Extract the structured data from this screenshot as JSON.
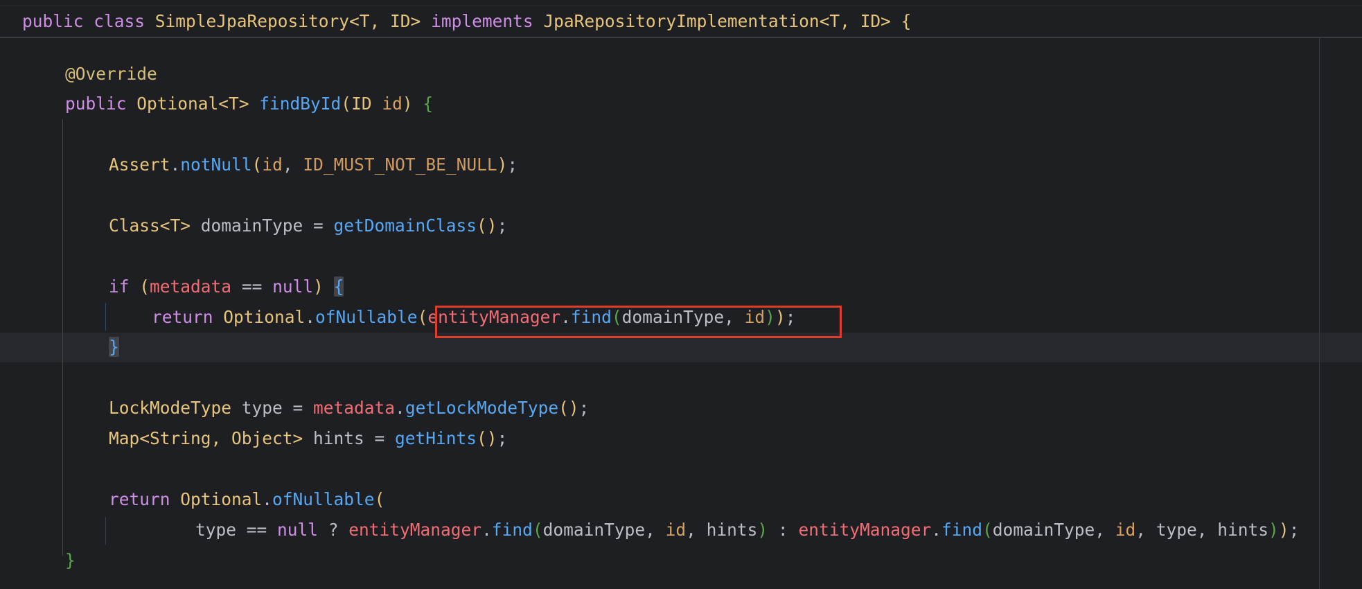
{
  "editor": {
    "language": "Java",
    "theme": {
      "background": "#1e1f22",
      "caret_row": "#26282e",
      "keyword": "#cf8ee6",
      "type": "#e7c47b",
      "function": "#56a8f5",
      "field": "#f26d73",
      "parameter": "#d9a15f",
      "default_text": "#bcbec4",
      "highlight_box": "#e03c2a"
    },
    "highlight": {
      "description": "red rectangle",
      "text": "(entityManager.find(domainType, id));"
    }
  },
  "code": {
    "l1": {
      "t1": "public",
      "t2": " ",
      "t3": "class",
      "t4": " SimpleJpaRepository<T, ID> ",
      "t5": "implements",
      "t6": " JpaRepositoryImplementation<T, ID> ",
      "t7": "{"
    },
    "l2": {
      "t1": "@Override"
    },
    "l3": {
      "t1": "public",
      "t2": " Optional<T> ",
      "t3": "findById",
      "t4": "(",
      "t5": "ID ",
      "t6": "id",
      "t7": ") ",
      "t8": "{"
    },
    "l4": {
      "t1": "Assert",
      "t2": ".",
      "t3": "notNull",
      "t4": "(",
      "t5": "id",
      "t6": ", ",
      "t7": "ID_MUST_NOT_BE_NULL",
      "t8": ")",
      "t9": ";"
    },
    "l5": {
      "t1": "Class<T>",
      "t2": " domainType = ",
      "t3": "getDomainClass",
      "t4": "()",
      "t5": ";"
    },
    "l6": {
      "t1": "if",
      "t2": " ",
      "t3": "(",
      "t4": "metadata",
      "t5": " == ",
      "t6": "null",
      "t7": ") ",
      "t8": "{"
    },
    "l7": {
      "t1": "return",
      "t2": " Optional",
      "t3": ".",
      "t4": "ofNullable",
      "t5": "(",
      "t6": "entityManager",
      "t7": ".",
      "t8": "find",
      "t9": "(",
      "t10": "domainType, ",
      "t11": "id",
      "t12": ")",
      "t13": ")",
      "t14": ";"
    },
    "l8": {
      "t1": "}"
    },
    "l9": {
      "t1": "LockModeType",
      "t2": " type = ",
      "t3": "metadata",
      "t4": ".",
      "t5": "getLockModeType",
      "t6": "()",
      "t7": ";"
    },
    "l10": {
      "t1": "Map<String, Object>",
      "t2": " hints = ",
      "t3": "getHints",
      "t4": "()",
      "t5": ";"
    },
    "l11": {
      "t1": "return",
      "t2": " Optional",
      "t3": ".",
      "t4": "ofNullable",
      "t5": "("
    },
    "l12": {
      "t1": "type == ",
      "t2": "null",
      "t3": " ? ",
      "t4": "entityManager",
      "t5": ".",
      "t6": "find",
      "t7": "(",
      "t8": "domainType, ",
      "t9": "id",
      "t10": ", hints",
      "t11": ")",
      "t12": " : ",
      "t13": "entityManager",
      "t14": ".",
      "t15": "find",
      "t16": "(",
      "t17": "domainType, ",
      "t18": "id",
      "t19": ", type, hints",
      "t20": ")",
      "t21": ")",
      "t22": ";"
    },
    "l13": {
      "t1": "}"
    }
  }
}
